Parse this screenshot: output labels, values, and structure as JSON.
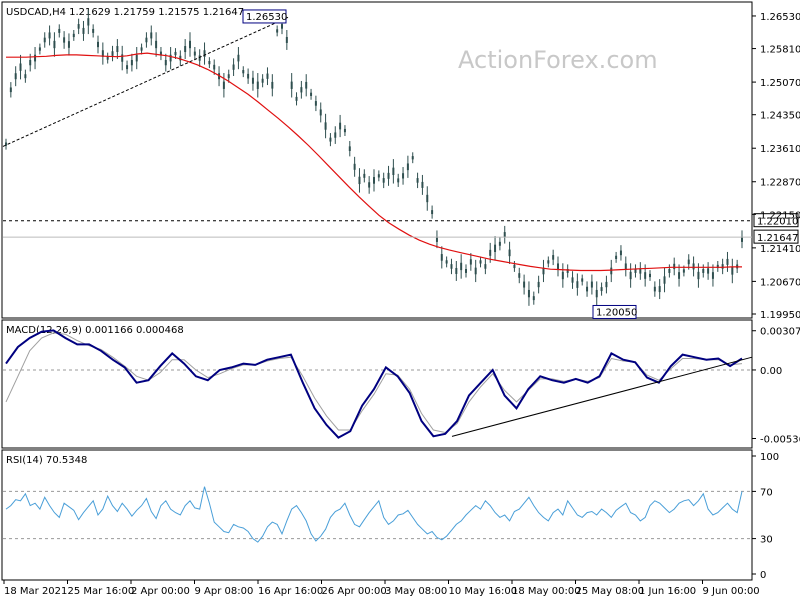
{
  "header": {
    "title": "USDCAD,H4 1.21629 1.21759 1.21575 1.21647"
  },
  "watermark": "ActionForex.com",
  "colors": {
    "background": "#ffffff",
    "candles": "#2f4f4f",
    "ma": "#e01010",
    "macd_line": "#000080",
    "macd_signal": "#a0a0a0",
    "rsi": "#4a9fd8",
    "trendline": "#000000"
  },
  "chart_data": [
    {
      "type": "line",
      "title": "USDCAD,H4 1.21629 1.21759 1.21575 1.21647",
      "xlabel": "",
      "ylabel": "",
      "x_ticks": [
        "18 Mar 2021",
        "25 Mar 16:00",
        "2 Apr 00:00",
        "9 Apr 08:00",
        "16 Apr 16:00",
        "26 Apr 00:00",
        "3 May 08:00",
        "10 May 16:00",
        "18 May 00:00",
        "25 May 08:00",
        "1 Jun 16:00",
        "9 Jun 00:00"
      ],
      "y_ticks": [
        "1.26530",
        "1.25810",
        "1.25070",
        "1.24350",
        "1.23610",
        "1.22870",
        "1.22150",
        "1.21410",
        "1.20670",
        "1.19950"
      ],
      "ylim": [
        1.1995,
        1.2675
      ],
      "series": [
        {
          "type": "price",
          "values": [
            1.237,
            1.249,
            1.252,
            1.254,
            1.252,
            1.255,
            1.256,
            1.258,
            1.26,
            1.261,
            1.259,
            1.262,
            1.26,
            1.259,
            1.261,
            1.263,
            1.262,
            1.264,
            1.262,
            1.259,
            1.257,
            1.256,
            1.257,
            1.258,
            1.256,
            1.254,
            1.255,
            1.256,
            1.258,
            1.26,
            1.261,
            1.259,
            1.257,
            1.255,
            1.256,
            1.257,
            1.256,
            1.258,
            1.259,
            1.257,
            1.256,
            1.257,
            1.255,
            1.254,
            1.252,
            1.25,
            1.252,
            1.254,
            1.256,
            1.253,
            1.252,
            1.251,
            1.25,
            1.251,
            1.252,
            1.25,
            1.262,
            1.263,
            1.26,
            1.25,
            1.247,
            1.249,
            1.25,
            1.248,
            1.246,
            1.244,
            1.241,
            1.238,
            1.239,
            1.241,
            1.24,
            1.236,
            1.232,
            1.229,
            1.23,
            1.228,
            1.229,
            1.23,
            1.229,
            1.23,
            1.231,
            1.229,
            1.23,
            1.232,
            1.234,
            1.229,
            1.228,
            1.225,
            1.222,
            1.216,
            1.212,
            1.211,
            1.21,
            1.209,
            1.21,
            1.209,
            1.211,
            1.209,
            1.211,
            1.21,
            1.213,
            1.214,
            1.215,
            1.217,
            1.213,
            1.21,
            1.208,
            1.206,
            1.204,
            1.203,
            1.206,
            1.209,
            1.211,
            1.212,
            1.21,
            1.208,
            1.209,
            1.207,
            1.206,
            1.207,
            1.205,
            1.206,
            1.204,
            1.205,
            1.206,
            1.209,
            1.212,
            1.213,
            1.21,
            1.208,
            1.209,
            1.209,
            1.208,
            1.208,
            1.205,
            1.205,
            1.207,
            1.209,
            1.21,
            1.208,
            1.209,
            1.211,
            1.21,
            1.208,
            1.209,
            1.209,
            1.208,
            1.21,
            1.21,
            1.211,
            1.209,
            1.21,
            1.216
          ],
          "name": ""
        },
        {
          "type": "moving_average",
          "values": [
            1.2562,
            1.2562,
            1.2562,
            1.2563,
            1.2564,
            1.2566,
            1.2567,
            1.2567,
            1.2566,
            1.2565,
            1.2564,
            1.2563,
            1.2565,
            1.2569,
            1.2571,
            1.2568,
            1.2565,
            1.256,
            1.2553,
            1.2545,
            1.2535,
            1.2523,
            1.251,
            1.2495,
            1.248,
            1.2463,
            1.2445,
            1.2427,
            1.2408,
            1.2388,
            1.2367,
            1.2345,
            1.2322,
            1.2299,
            1.2276,
            1.2254,
            1.2233,
            1.2213,
            1.2196,
            1.2182,
            1.2169,
            1.2158,
            1.2149,
            1.2142,
            1.2136,
            1.2131,
            1.2126,
            1.2121,
            1.2116,
            1.2112,
            1.2108,
            1.2104,
            1.21,
            1.2097,
            1.2094,
            1.2093,
            1.2092,
            1.2091,
            1.2091,
            1.2091,
            1.2092,
            1.2093,
            1.2094,
            1.2095,
            1.2096,
            1.2097,
            1.2098,
            1.2098,
            1.2098,
            1.2098,
            1.2098,
            1.2098,
            1.2099,
            1.2099
          ],
          "name": ""
        }
      ],
      "annotations": [
        "1.26530",
        "1.20050",
        "1.22010",
        "1.21647"
      ],
      "levels": {
        "high": 1.2653,
        "low": 1.2005,
        "resistance": 1.2201,
        "last": 1.21647
      },
      "watermark": "ActionForex.com"
    },
    {
      "type": "line",
      "title": "MACD(12,26,9) 0.001166 0.000468",
      "xlabel": "",
      "ylabel": "",
      "y_ticks": [
        "0.003072",
        "0.00",
        "-0.005369"
      ],
      "ylim": [
        -0.0058,
        0.0036
      ],
      "series": [
        {
          "type": "macd",
          "values": [
            0.0005,
            0.0018,
            0.0025,
            0.003,
            0.0031,
            0.0025,
            0.002,
            0.002,
            0.0015,
            0.0008,
            0.0002,
            -0.001,
            -0.0008,
            0.0003,
            0.0013,
            0.0005,
            -0.0005,
            -0.0008,
            0.0,
            0.0002,
            0.0005,
            0.0004,
            0.0008,
            0.001,
            0.0012,
            -0.001,
            -0.003,
            -0.0043,
            -0.0053,
            -0.0048,
            -0.0028,
            -0.0015,
            0.0002,
            -0.0005,
            -0.0018,
            -0.004,
            -0.0052,
            -0.005,
            -0.004,
            -0.002,
            -0.001,
            0.0,
            -0.002,
            -0.003,
            -0.0015,
            -0.0005,
            -0.0008,
            -0.001,
            -0.0007,
            -0.001,
            -0.0005,
            0.0013,
            0.0008,
            0.0006,
            -0.0006,
            -0.001,
            0.0003,
            0.0012,
            0.001,
            0.0008,
            0.0009,
            0.0003,
            0.0009
          ],
          "name": ""
        },
        {
          "type": "signal",
          "values": [
            -0.0025,
            -0.0005,
            0.0015,
            0.0025,
            0.0029,
            0.0028,
            0.0023,
            0.0019,
            0.0016,
            0.001,
            0.0003,
            -0.0005,
            -0.0008,
            -0.0002,
            0.0008,
            0.0008,
            0.0,
            -0.0006,
            -0.0003,
            0.0001,
            0.0004,
            0.0004,
            0.0007,
            0.0009,
            0.001,
            -0.0005,
            -0.0022,
            -0.0036,
            -0.0047,
            -0.0047,
            -0.0032,
            -0.0019,
            -0.0003,
            -0.0004,
            -0.0015,
            -0.0034,
            -0.0047,
            -0.0049,
            -0.0042,
            -0.0025,
            -0.0013,
            -0.0003,
            -0.0016,
            -0.0025,
            -0.0016,
            -0.0007,
            -0.0007,
            -0.0009,
            -0.0007,
            -0.0009,
            -0.0006,
            0.0009,
            0.0007,
            0.0006,
            -0.0004,
            -0.0008,
            0.0001,
            0.0009,
            0.0009,
            0.0008,
            0.0008,
            0.0004,
            0.0005
          ],
          "name": ""
        }
      ],
      "trendline": {
        "from": -0.0052,
        "to": 0.001
      }
    },
    {
      "type": "line",
      "title": "RSI(14) 70.5348",
      "xlabel": "",
      "ylabel": "",
      "y_ticks": [
        "100",
        "70",
        "30",
        "0"
      ],
      "ylim": [
        0,
        100
      ],
      "levels": [
        70,
        30
      ],
      "series": [
        {
          "type": "rsi",
          "values": [
            55,
            58,
            63,
            62,
            68,
            58,
            60,
            55,
            65,
            58,
            52,
            48,
            60,
            57,
            54,
            46,
            52,
            57,
            62,
            50,
            55,
            66,
            58,
            53,
            60,
            55,
            49,
            54,
            58,
            64,
            53,
            47,
            58,
            62,
            55,
            52,
            50,
            58,
            62,
            56,
            55,
            74,
            60,
            44,
            40,
            36,
            35,
            42,
            40,
            39,
            36,
            30,
            27,
            32,
            40,
            44,
            42,
            34,
            45,
            55,
            58,
            52,
            45,
            34,
            28,
            32,
            38,
            48,
            53,
            55,
            60,
            50,
            42,
            40,
            46,
            52,
            57,
            62,
            48,
            42,
            45,
            50,
            51,
            54,
            48,
            42,
            38,
            34,
            36,
            31,
            29,
            32,
            37,
            42,
            45,
            50,
            54,
            58,
            55,
            62,
            58,
            52,
            48,
            50,
            45,
            53,
            55,
            60,
            65,
            58,
            52,
            48,
            45,
            52,
            55,
            50,
            62,
            56,
            50,
            48,
            52,
            53,
            50,
            55,
            52,
            48,
            54,
            57,
            60,
            52,
            50,
            45,
            48,
            58,
            62,
            60,
            56,
            52,
            55,
            60,
            62,
            63,
            58,
            62,
            68,
            55,
            50,
            52,
            56,
            60,
            55,
            52,
            70
          ],
          "name": ""
        }
      ]
    }
  ]
}
